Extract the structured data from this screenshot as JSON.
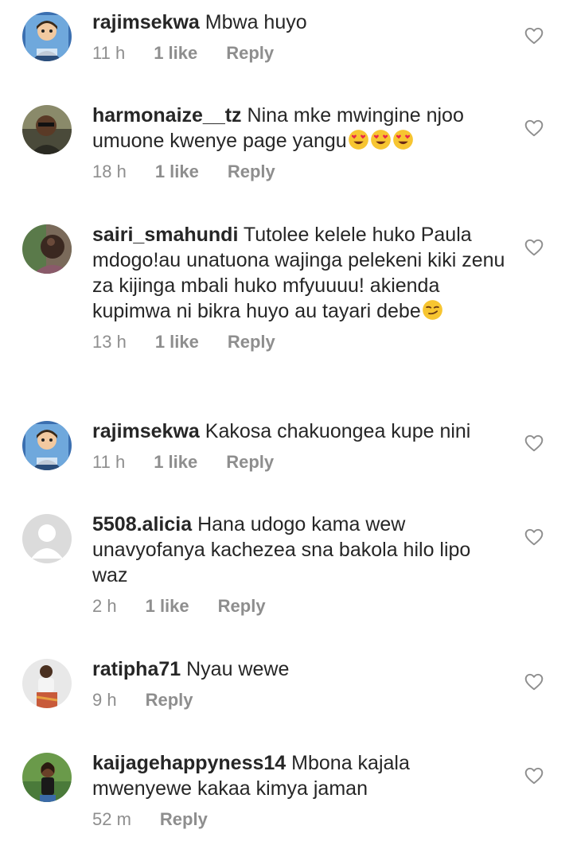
{
  "comments": [
    {
      "username": "rajimsekwa",
      "text": "Mbwa huyo",
      "time": "11 h",
      "likes": "1 like",
      "reply": "Reply",
      "avatar": "cartoon-avatar"
    },
    {
      "username": "harmonaize__tz",
      "text": "Nina mke mwingine njoo umuone kwenye page yangu",
      "emojis": [
        "heart-eyes-emoji",
        "heart-eyes-emoji",
        "heart-eyes-emoji"
      ],
      "time": "18 h",
      "likes": "1 like",
      "reply": "Reply",
      "avatar": "photo-avatar"
    },
    {
      "username": "sairi_smahundi",
      "text": "Tutolee kelele huko Paula mdogo!au unatuona wajinga pelekeni kiki zenu za kijinga mbali huko mfyuuuu! akienda kupimwa ni bikra huyo au tayari debe",
      "emojis": [
        "smirk-emoji"
      ],
      "time": "13 h",
      "likes": "1 like",
      "reply": "Reply",
      "avatar": "photo-avatar"
    },
    {
      "username": "rajimsekwa",
      "text": "Kakosa chakuongea kupe nini",
      "time": "11 h",
      "likes": "1 like",
      "reply": "Reply",
      "avatar": "cartoon-avatar"
    },
    {
      "username": "5508.alicia",
      "text": "Hana udogo kama wew unavyofanya kachezea sna bakola hilo lipo waz",
      "time": "2 h",
      "likes": "1 like",
      "reply": "Reply",
      "avatar": "default-avatar"
    },
    {
      "username": "ratipha71",
      "text": "Nyau wewe",
      "time": "9 h",
      "reply": "Reply",
      "avatar": "photo-avatar"
    },
    {
      "username": "kaijagehappyness14",
      "text": "Mbona kajala mwenyewe kakaa kimya jaman",
      "time": "52 m",
      "reply": "Reply",
      "avatar": "photo-avatar"
    }
  ],
  "icons": {
    "like": "heart-outline-icon"
  },
  "colors": {
    "text": "#262626",
    "meta": "#8e8e8e",
    "heart": "#8e8e8e",
    "background": "#ffffff"
  }
}
